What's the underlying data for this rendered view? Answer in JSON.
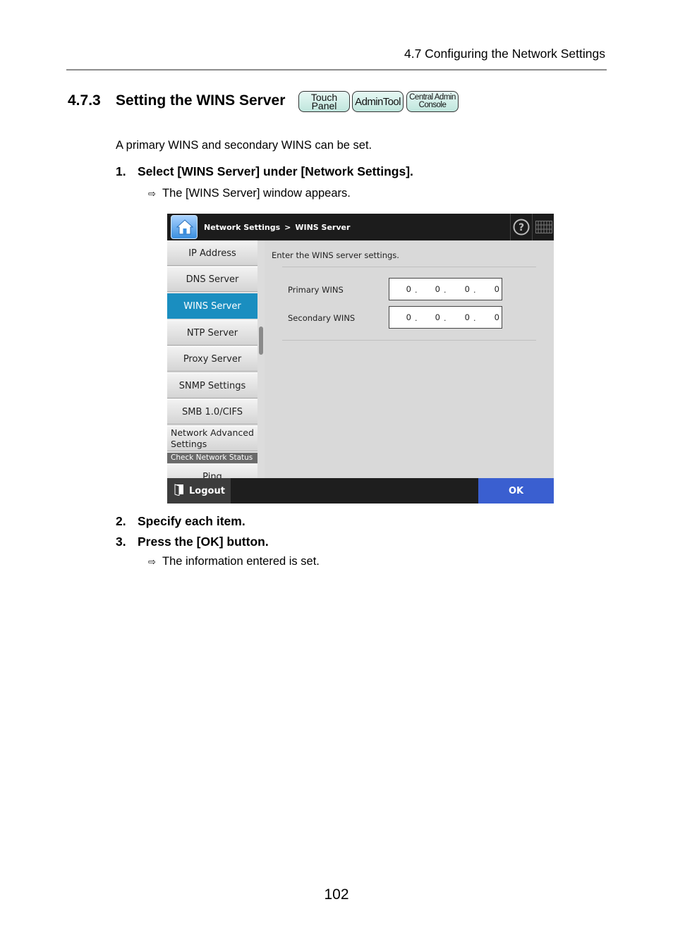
{
  "header": {
    "running_title": "4.7 Configuring the Network Settings"
  },
  "section": {
    "number": "4.7.3",
    "title": "Setting the WINS Server",
    "badges": {
      "touch_line1": "Touch",
      "touch_line2": "Panel",
      "admin": "AdminTool",
      "central_line1": "Central Admin",
      "central_line2": "Console"
    }
  },
  "intro": "A primary WINS and secondary WINS can be set.",
  "steps": [
    {
      "num": "1.",
      "text": "Select [WINS Server] under [Network Settings].",
      "result": "The [WINS Server] window appears."
    },
    {
      "num": "2.",
      "text": "Specify each item."
    },
    {
      "num": "3.",
      "text": "Press the [OK] button.",
      "result": "The information entered is set."
    }
  ],
  "screenshot": {
    "breadcrumb": {
      "parent": "Network Settings",
      "separator": ">",
      "current": "WINS Server"
    },
    "sidebar": {
      "items": [
        "IP Address",
        "DNS Server",
        "WINS Server",
        "NTP Server",
        "Proxy Server",
        "SNMP Settings",
        "SMB 1.0/CIFS",
        "Network Advanced Settings"
      ],
      "active": "WINS Server",
      "group_header": "Check Network Status",
      "group_items": [
        "Ping"
      ]
    },
    "instruction": "Enter the WINS server settings.",
    "fields": [
      {
        "label": "Primary WINS",
        "octets": [
          "0",
          "0",
          "0",
          "0"
        ]
      },
      {
        "label": "Secondary WINS",
        "octets": [
          "0",
          "0",
          "0",
          "0"
        ]
      }
    ],
    "logout_label": "Logout",
    "ok_label": "OK"
  },
  "page_number": "102",
  "icons": [
    "home-icon",
    "help-icon",
    "keyboard-icon",
    "logout-icon",
    "result-arrow-icon"
  ]
}
